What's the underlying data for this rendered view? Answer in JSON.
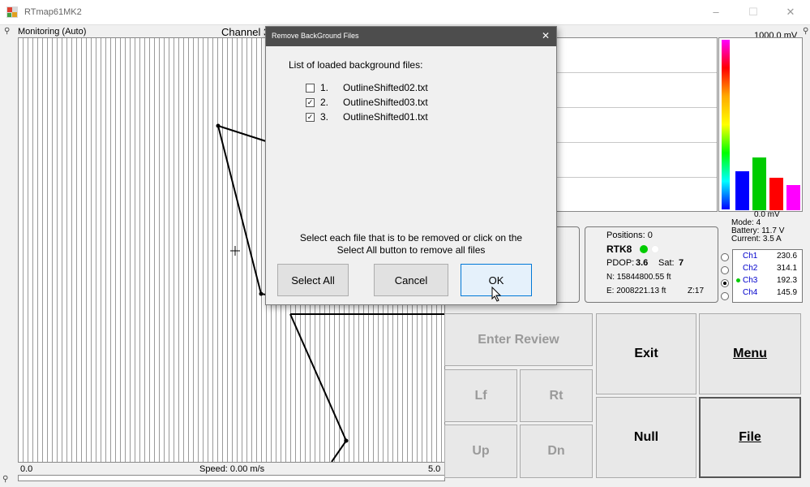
{
  "window": {
    "title": "RTmap61MK2",
    "minimize": "–",
    "maximize": "☐",
    "close": "✕"
  },
  "plot": {
    "mode_label": "Monitoring (Auto)",
    "channel_label": "Channel 3",
    "x_min": "0.0",
    "x_max": "5.0",
    "speed_label": "Speed: 0.00 m/s"
  },
  "meter": {
    "top_label": "1000.0 mV",
    "bottom_label": "0.0 mV",
    "bars": [
      {
        "channel": "Ch1",
        "color": "#0000ff",
        "level": 0.23
      },
      {
        "channel": "Ch2",
        "color": "#00cc00",
        "level": 0.31
      },
      {
        "channel": "Ch3",
        "color": "#ff0000",
        "level": 0.19
      },
      {
        "channel": "Ch4",
        "color": "#ff00ff",
        "level": 0.15
      }
    ],
    "scale_colors": [
      "#ff00ff",
      "#ff0000",
      "#ffaa00",
      "#ffff00",
      "#00ff00",
      "#00ffff",
      "#0000ff"
    ]
  },
  "status": {
    "mode": "Mode:  4",
    "battery": "Battery:  11.7 V",
    "current": "Current:  3.5 A"
  },
  "gps": {
    "positions": "Positions: 0",
    "rtk": "RTK8",
    "pdop_label": "PDOP:",
    "pdop_value": "3.6",
    "sat_label": "Sat:",
    "sat_value": "7",
    "north": "N: 15844800.55 ft",
    "east": "E: 2008221.13 ft",
    "zone": "Z:17"
  },
  "channels": [
    {
      "name": "Ch1",
      "value": "230.6",
      "selected": false
    },
    {
      "name": "Ch2",
      "value": "314.1",
      "selected": false
    },
    {
      "name": "Ch3",
      "value": "192.3",
      "selected": true
    },
    {
      "name": "Ch4",
      "value": "145.9",
      "selected": false
    }
  ],
  "buttons": {
    "enter_review": "Enter Review",
    "exit": "Exit",
    "menu": "Menu",
    "lf": "Lf",
    "rt": "Rt",
    "null": "Null",
    "file": "File",
    "up": "Up",
    "dn": "Dn"
  },
  "dialog": {
    "title": "Remove BackGround Files",
    "close": "✕",
    "heading": "List of loaded background files:",
    "files": [
      {
        "num": "1.",
        "name": "OutlineShifted02.txt",
        "checked": false
      },
      {
        "num": "2.",
        "name": "OutlineShifted03.txt",
        "checked": true
      },
      {
        "num": "3.",
        "name": "OutlineShifted01.txt",
        "checked": true
      }
    ],
    "instruction_line1": "Select each file that is to be removed or click on the",
    "instruction_line2": "Select All button to remove all files",
    "select_all": "Select All",
    "cancel": "Cancel",
    "ok": "OK"
  }
}
